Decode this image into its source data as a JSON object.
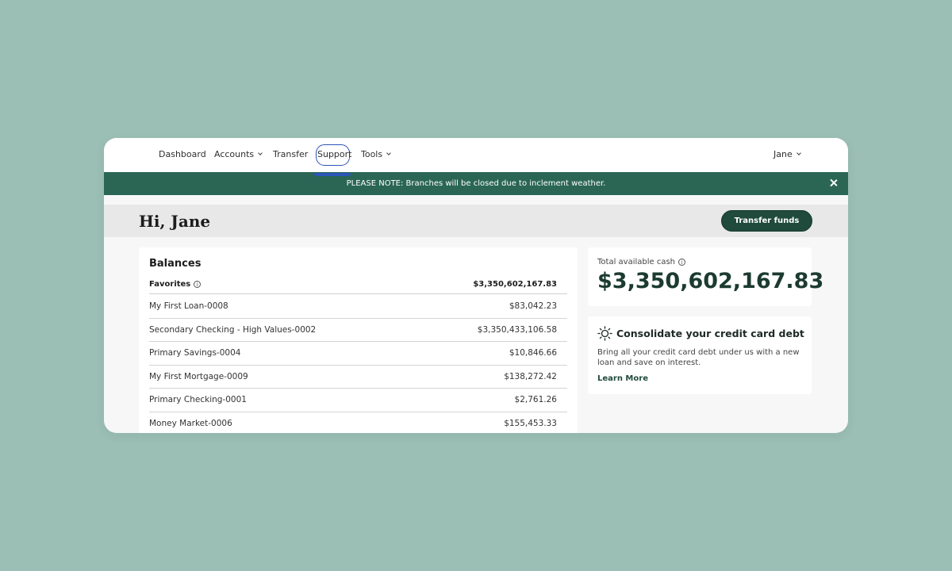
{
  "nav": {
    "items": [
      {
        "label": "Dashboard"
      },
      {
        "label": "Accounts"
      },
      {
        "label": "Transfer"
      },
      {
        "label": "Support"
      },
      {
        "label": "Tools"
      }
    ],
    "user_label": "Jane"
  },
  "banner": {
    "text": "PLEASE NOTE: Branches will be closed due to inclement weather."
  },
  "greeting": {
    "title": "Hi, Jane",
    "transfer_button": "Transfer funds"
  },
  "balances": {
    "title": "Balances",
    "favorites_label": "Favorites",
    "favorites_total": "$3,350,602,167.83",
    "accounts": [
      {
        "name": "My First Loan-0008",
        "balance": "$83,042.23"
      },
      {
        "name": "Secondary Checking - High Values-0002",
        "balance": "$3,350,433,106.58"
      },
      {
        "name": "Primary Savings-0004",
        "balance": "$10,846.66"
      },
      {
        "name": "My First Mortgage-0009",
        "balance": "$138,272.42"
      },
      {
        "name": "Primary Checking-0001",
        "balance": "$2,761.26"
      },
      {
        "name": "Money Market-0006",
        "balance": "$155,453.33"
      }
    ]
  },
  "cash": {
    "label": "Total available cash",
    "value": "$3,350,602,167.83"
  },
  "promo": {
    "icon": "sun-icon",
    "title": "Consolidate your credit card debt",
    "text": "Bring all your credit card debt under us with a new loan and save on interest.",
    "link": "Learn More"
  },
  "colors": {
    "background": "#9bbfb4",
    "banner": "#2b6655",
    "accent": "#1f4a3c",
    "focus_ring": "#2c55b8"
  }
}
